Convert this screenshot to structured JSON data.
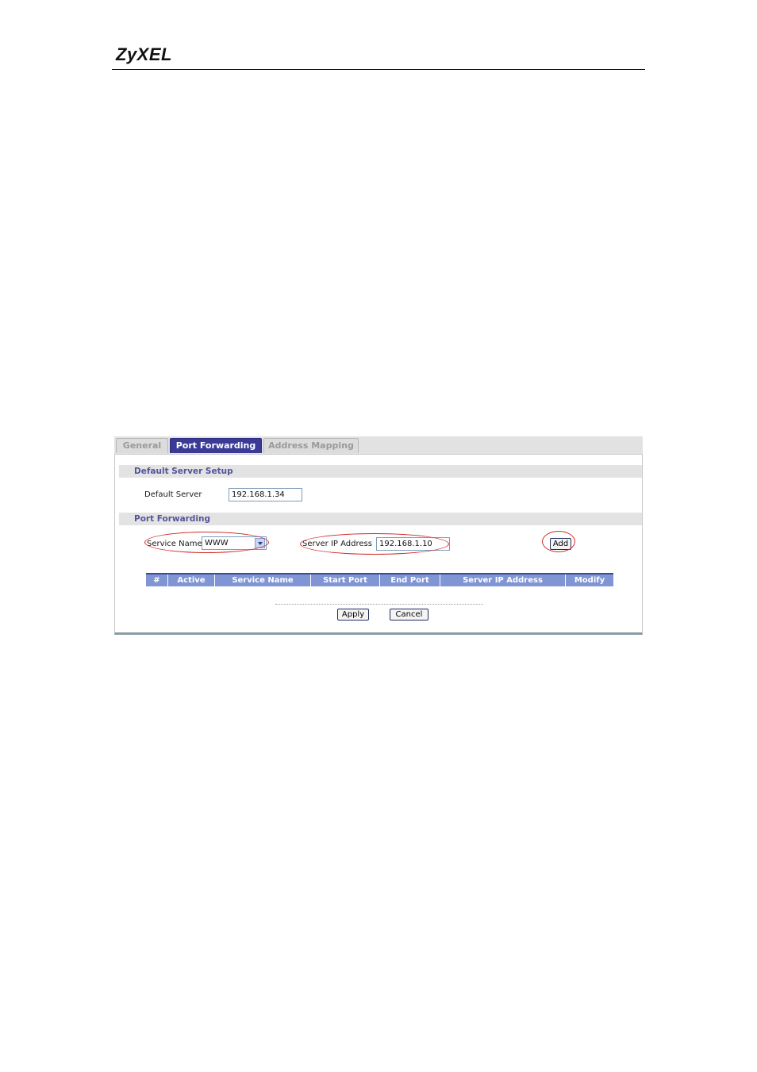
{
  "document": {
    "logo_text": "ZyXEL"
  },
  "tabs": [
    {
      "label": "General",
      "active": false
    },
    {
      "label": "Port Forwarding",
      "active": true
    },
    {
      "label": "Address Mapping",
      "active": false
    }
  ],
  "default_server_section": {
    "title": "Default Server Setup",
    "label": "Default Server",
    "value": "192.168.1.34"
  },
  "port_forwarding_section": {
    "title": "Port Forwarding",
    "service_name_label": "Service Name",
    "service_name_value": "WWW",
    "server_ip_label": "Server IP Address",
    "server_ip_value": "192.168.1.10",
    "add_label": "Add"
  },
  "table": {
    "columns": [
      "#",
      "Active",
      "Service Name",
      "Start Port",
      "End Port",
      "Server IP Address",
      "Modify"
    ]
  },
  "actions": {
    "apply_label": "Apply",
    "cancel_label": "Cancel"
  },
  "colors": {
    "active_tab": "#3c3a97",
    "section_title": "#54549a",
    "table_header": "#7f95d4",
    "highlight_oval": "#d12a2a"
  }
}
